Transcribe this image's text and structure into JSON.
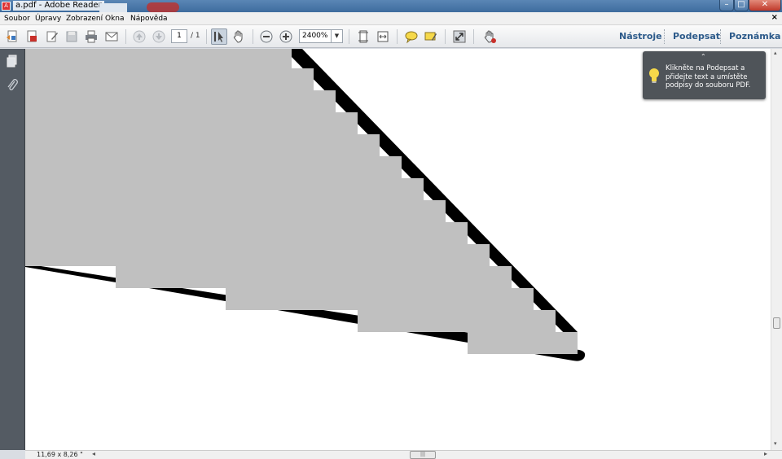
{
  "window": {
    "title": "a.pdf - Adobe Reader",
    "minimize_label": "–",
    "maximize_label": "□",
    "close_label": "✕"
  },
  "menubar": {
    "items": [
      "Soubor",
      "Úpravy",
      "Zobrazení",
      "Okna",
      "Nápověda"
    ],
    "close_doc": "×"
  },
  "toolbar": {
    "page_current": "1",
    "page_total": "/ 1",
    "zoom_value": "2400%",
    "tools_label": "Nástroje",
    "sign_label": "Podepsat",
    "comment_label": "Poznámka"
  },
  "tooltip": {
    "caret": "⌃",
    "text": "Klikněte na Podepsat a přidejte text a umístěte podpisy do souboru PDF."
  },
  "statusbar": {
    "page_size": "11,69 x 8,26 \"",
    "scroll_left": "◂",
    "scroll_right": "▸",
    "thumb_grip": "|||"
  },
  "scrollbar": {
    "up": "▴",
    "down": "▾",
    "grip": "≡"
  },
  "colors": {
    "accent": "#2c5a8a",
    "shape_gray": "#c0c0c0",
    "shape_black": "#000000",
    "panel": "#545b63"
  }
}
